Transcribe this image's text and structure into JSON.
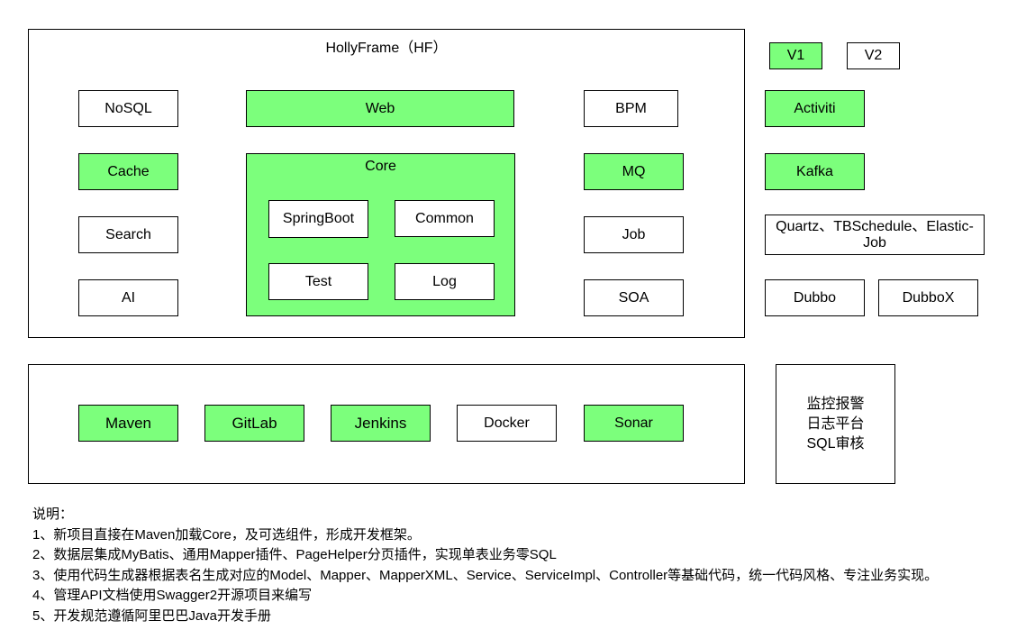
{
  "colors": {
    "enabled": "#7cff7c",
    "disabled": "#ffffff",
    "border": "#000000"
  },
  "hf": {
    "title": "HollyFrame（HF）",
    "left": [
      {
        "label": "NoSQL",
        "on": false
      },
      {
        "label": "Cache",
        "on": true
      },
      {
        "label": "Search",
        "on": false
      },
      {
        "label": "AI",
        "on": false
      }
    ],
    "web": {
      "label": "Web",
      "on": true
    },
    "core": {
      "title": "Core",
      "modules": [
        {
          "label": "SpringBoot"
        },
        {
          "label": "Common"
        },
        {
          "label": "Test"
        },
        {
          "label": "Log"
        }
      ]
    },
    "right": [
      {
        "label": "BPM",
        "on": false
      },
      {
        "label": "MQ",
        "on": true
      },
      {
        "label": "Job",
        "on": false
      },
      {
        "label": "SOA",
        "on": false
      }
    ]
  },
  "legend": {
    "v1": {
      "label": "V1",
      "on": true
    },
    "v2": {
      "label": "V2",
      "on": false
    }
  },
  "impl": {
    "bpm": {
      "label": "Activiti",
      "on": true
    },
    "mq": {
      "label": "Kafka",
      "on": true
    },
    "job": {
      "label": "Quartz、TBSchedule、Elastic-Job",
      "on": false
    },
    "soa": [
      {
        "label": "Dubbo",
        "on": false
      },
      {
        "label": "DubboX",
        "on": false
      }
    ]
  },
  "devops": [
    {
      "label": "Maven",
      "on": true
    },
    {
      "label": "GitLab",
      "on": true
    },
    {
      "label": "Jenkins",
      "on": true
    },
    {
      "label": "Docker",
      "on": false
    },
    {
      "label": "Sonar",
      "on": true
    }
  ],
  "monitor": {
    "lines": [
      "监控报警",
      "日志平台",
      "SQL审核"
    ]
  },
  "notes": {
    "heading": "说明：",
    "items": [
      "1、新项目直接在Maven加载Core，及可选组件，形成开发框架。",
      "2、数据层集成MyBatis、通用Mapper插件、PageHelper分页插件，实现单表业务零SQL",
      "3、使用代码生成器根据表名生成对应的Model、Mapper、MapperXML、Service、ServiceImpl、Controller等基础代码，统一代码风格、专注业务实现。",
      "4、管理API文档使用Swagger2开源项目来编写",
      "5、开发规范遵循阿里巴巴Java开发手册"
    ]
  }
}
